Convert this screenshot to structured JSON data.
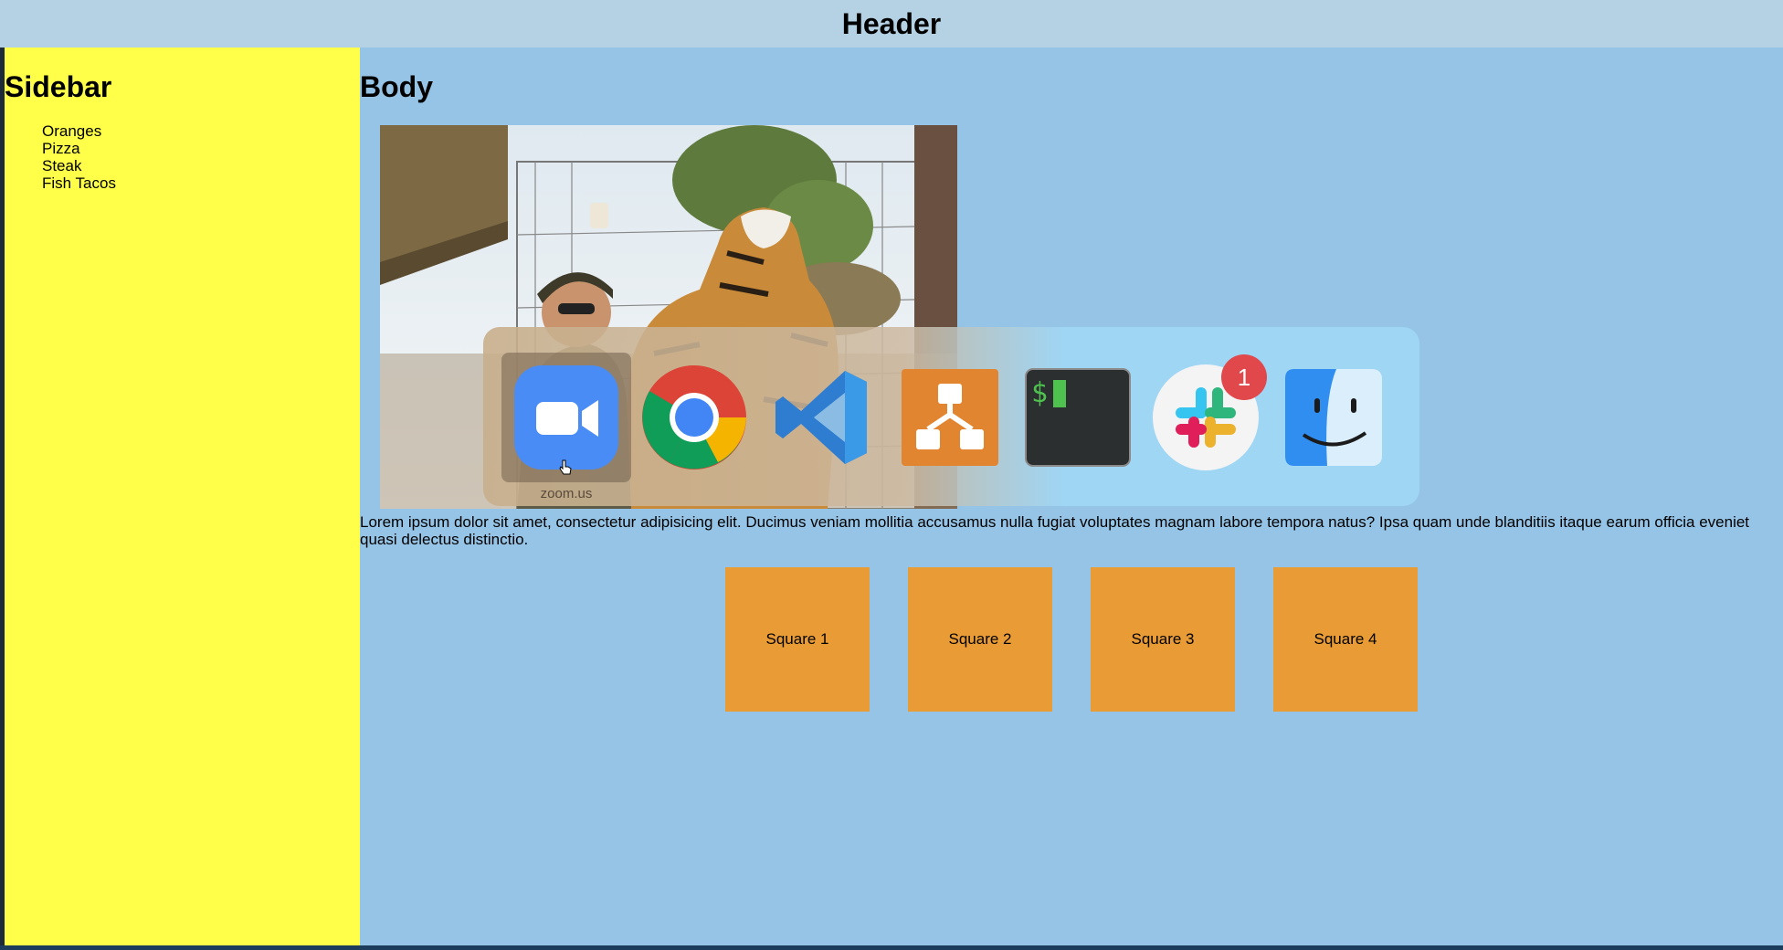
{
  "header": {
    "title": "Header"
  },
  "sidebar": {
    "title": "Sidebar",
    "items": [
      "Oranges",
      "Pizza",
      "Steak",
      "Fish Tacos"
    ]
  },
  "main": {
    "title": "Body",
    "lorem": "Lorem ipsum dolor sit amet, consectetur adipisicing elit. Ducimus veniam mollitia accusamus nulla fugiat voluptates magnam labore tempora natus? Ipsa quam unde blanditiis itaque earum officia eveniet quasi delectus distinctio.",
    "squares": [
      "Square 1",
      "Square 2",
      "Square 3",
      "Square 4"
    ]
  },
  "app_switcher": {
    "selected_caption": "zoom.us",
    "apps": [
      "zoom-icon",
      "chrome-icon",
      "vscode-icon",
      "sourcetree-icon",
      "terminal-icon",
      "slack-icon",
      "finder-icon"
    ],
    "slack_badge": "1",
    "terminal_prompt": "$"
  },
  "colors": {
    "page_bg": "#96c4e6",
    "header_bg": "#b4d2e4",
    "sidebar_bg": "#ffff4a",
    "square_bg": "#e99c35"
  }
}
